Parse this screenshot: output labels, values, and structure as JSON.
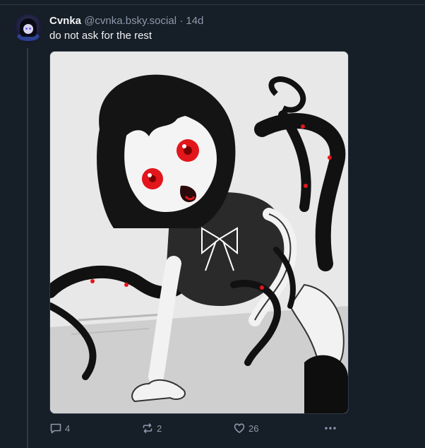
{
  "post": {
    "author": {
      "display_name": "Cvnka",
      "handle": "@cvnka.bsky.social"
    },
    "separator": "·",
    "timestamp": "14d",
    "text": "do not ask for the rest",
    "image": {
      "subject": "illustration-greyscale-girl-with-tentacles"
    },
    "actions": {
      "reply": {
        "icon": "reply-icon",
        "count": "4"
      },
      "repost": {
        "icon": "repost-icon",
        "count": "2"
      },
      "like": {
        "icon": "heart-icon",
        "count": "26"
      },
      "more": {
        "icon": "more-icon"
      }
    }
  },
  "colors": {
    "background": "#161e27",
    "border": "#2e3a48",
    "text_primary": "#f1f3f5",
    "text_secondary": "#8d9aab",
    "accent_red": "#e2161b"
  }
}
